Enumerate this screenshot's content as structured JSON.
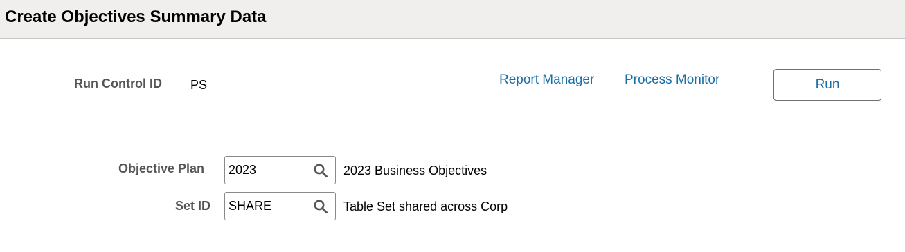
{
  "header": {
    "title": "Create Objectives Summary Data"
  },
  "run_control": {
    "label": "Run Control ID",
    "value": "PS"
  },
  "links": {
    "report_manager": "Report Manager",
    "process_monitor": "Process Monitor"
  },
  "run_button": {
    "label": "Run"
  },
  "fields": {
    "objective_plan": {
      "label": "Objective Plan",
      "value": "2023",
      "description": "2023 Business Objectives",
      "icon": "search-icon"
    },
    "set_id": {
      "label": "Set ID",
      "value": "SHARE",
      "description": "Table Set shared across Corp",
      "icon": "search-icon"
    }
  },
  "colors": {
    "header_bg": "#f1efed",
    "link": "#1a6ea8",
    "label": "#555555"
  }
}
